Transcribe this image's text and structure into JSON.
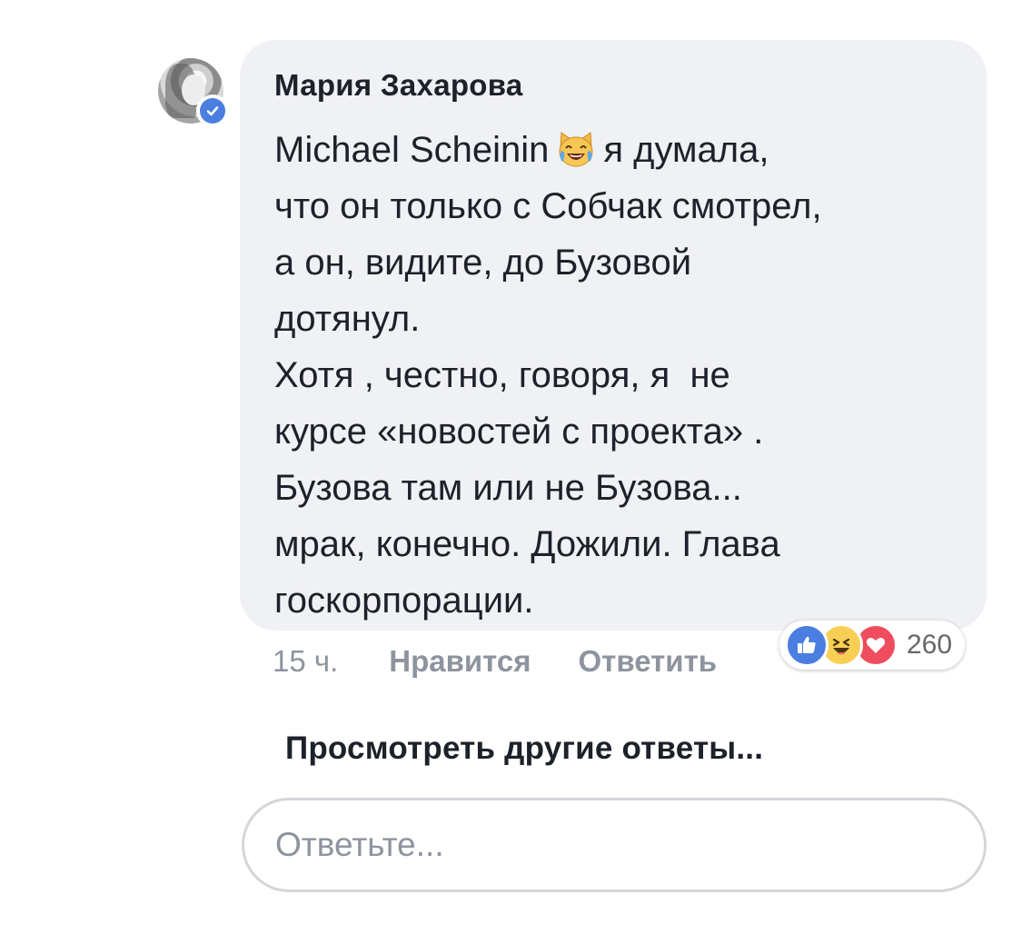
{
  "comment": {
    "author": "Мария Захарова",
    "mention": "Michael Scheinin",
    "emoji": "joy-cat-icon",
    "text_lines": [
      "я думала,",
      "что он только с Собчак смотрел,",
      "а он, видите, до Бузовой",
      "дотянул.",
      "Хотя , честно, говоря, я  не",
      "курсе «новостей с проекта» .",
      "Бузова там или не Бузова...",
      "мрак, конечно. Дожили. Глава",
      "госкорпорации."
    ],
    "time": "15 ч.",
    "like_label": "Нравится",
    "reply_label": "Ответить",
    "reaction_count": "260",
    "reactions": [
      "like-icon",
      "haha-icon",
      "love-icon"
    ]
  },
  "more_replies": "Просмотреть другие ответы...",
  "reply_box": {
    "placeholder": "Ответьте..."
  },
  "colors": {
    "bubble": "#f0f1f4",
    "like": "#4a7ee0",
    "haha": "#f7cf55",
    "love": "#ef4d5d",
    "muted": "#8d949e"
  }
}
